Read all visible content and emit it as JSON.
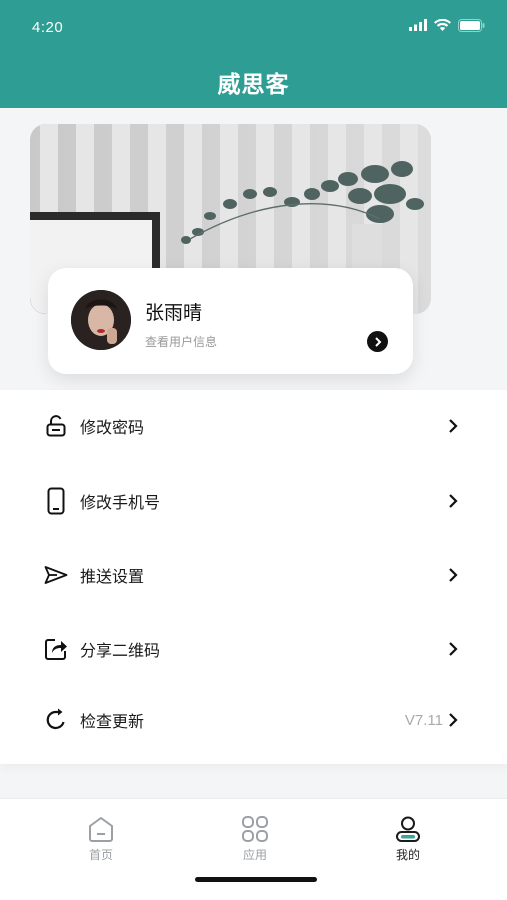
{
  "status_bar": {
    "time": "4:20"
  },
  "header": {
    "title": "威思客"
  },
  "profile": {
    "name": "张雨晴",
    "subtitle": "查看用户信息"
  },
  "menu": [
    {
      "label": "修改密码",
      "icon": "lock-icon"
    },
    {
      "label": "修改手机号",
      "icon": "phone-icon"
    },
    {
      "label": "推送设置",
      "icon": "send-icon"
    },
    {
      "label": "分享二维码",
      "icon": "share-icon"
    },
    {
      "label": "检查更新",
      "icon": "refresh-icon",
      "version": "V7.11"
    }
  ],
  "tabbar": [
    {
      "label": "首页",
      "icon": "home-icon",
      "active": false
    },
    {
      "label": "应用",
      "icon": "apps-icon",
      "active": false
    },
    {
      "label": "我的",
      "icon": "user-icon",
      "active": true
    }
  ],
  "colors": {
    "header_bg": "#2e9e94",
    "accent": "#3aa69b"
  }
}
